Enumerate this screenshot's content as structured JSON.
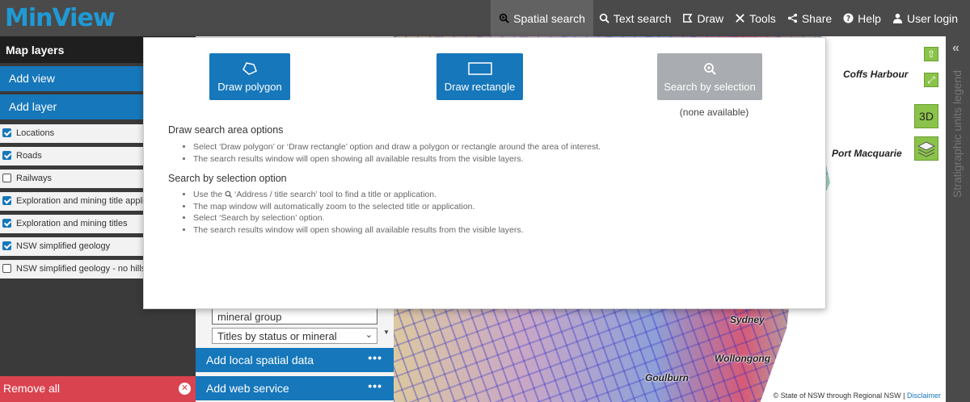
{
  "app": {
    "logo": "MinView"
  },
  "nav": {
    "items": [
      {
        "label": "Spatial search",
        "icon": "search-area-icon",
        "active": true
      },
      {
        "label": "Text search",
        "icon": "search-icon"
      },
      {
        "label": "Draw",
        "icon": "draw-icon"
      },
      {
        "label": "Tools",
        "icon": "tools-icon"
      },
      {
        "label": "Share",
        "icon": "share-icon"
      },
      {
        "label": "Help",
        "icon": "help-icon"
      },
      {
        "label": "User login",
        "icon": "user-icon"
      }
    ]
  },
  "sidebar": {
    "title": "Map layers",
    "add_view": "Add view",
    "add_layer": "Add layer",
    "layers": [
      {
        "label": "Locations",
        "checked": true
      },
      {
        "label": "Roads",
        "checked": true
      },
      {
        "label": "Railways",
        "checked": false
      },
      {
        "label": "Exploration and mining title applications",
        "checked": true
      },
      {
        "label": "Exploration and mining titles",
        "checked": true
      },
      {
        "label": "NSW simplified geology",
        "checked": true
      },
      {
        "label": "NSW simplified geology - no hillshade",
        "checked": false
      }
    ],
    "remove_all": "Remove all"
  },
  "mid_panel": {
    "input_value": "mineral group",
    "select_value": "Titles by status or mineral",
    "add_local": "Add local spatial data",
    "add_web": "Add web service",
    "more": "•••"
  },
  "map": {
    "cities": [
      "Coffs Harbour",
      "Port Macquarie",
      "Sydney",
      "Wollongong",
      "Goulburn"
    ],
    "three_d": "3D",
    "attribution": "© State of NSW through Regional NSW | ",
    "disclaimer": "Disclaimer",
    "legend_label": "Stratigraphic units legend"
  },
  "modal": {
    "draw_polygon": "Draw polygon",
    "draw_rectangle": "Draw rectangle",
    "search_by_selection": "Search by selection",
    "none_available": "(none available)",
    "section1_title": "Draw search area options",
    "section1_bullets": [
      "Select ‘Draw polygon’ or ‘Draw rectangle’ option and draw a polygon or rectangle around the area of interest.",
      "The search results window will open showing all available results from the visible layers."
    ],
    "section2_title": "Search by selection option",
    "section2_bullet1_pre": "Use the",
    "section2_bullet1_post": "‘Address / title search’ tool to find a title or application.",
    "section2_bullets": [
      "The map window will automatically zoom to the selected title or application.",
      "Select ‘Search by selection’ option.",
      "The search results window will open showing all available results from the visible layers."
    ]
  },
  "colors": {
    "brand_blue": "#1677bb",
    "logo_blue": "#1e9ad6",
    "remove_red": "#d9434f",
    "map_tool_green": "#8bc34a"
  }
}
